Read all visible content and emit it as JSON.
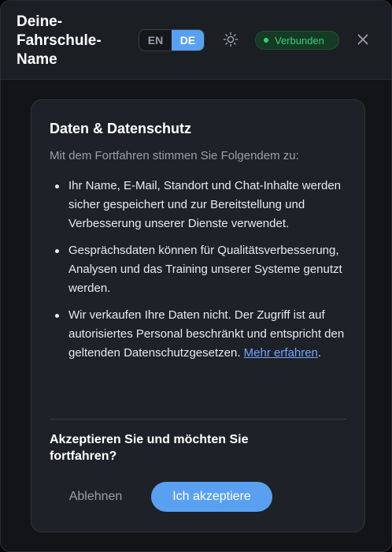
{
  "header": {
    "title": "Deine-Fahrschule-Name",
    "languages": [
      {
        "label": "EN",
        "active": false
      },
      {
        "label": "DE",
        "active": true
      }
    ],
    "theme_icon": "sun-icon",
    "status": {
      "label": "Verbunden",
      "color": "#3bcf74"
    },
    "close_icon": "close-icon"
  },
  "consent": {
    "title": "Daten & Datenschutz",
    "intro": "Mit dem Fortfahren stimmen Sie Folgendem zu:",
    "bullets": [
      "Ihr Name, E-Mail, Standort und Chat-Inhalte werden sicher gespeichert und zur Bereitstellung und Verbesserung unserer Dienste verwendet.",
      "Gesprächsdaten können für Qualitätsverbesserung, Analysen und das Training unserer Systeme genutzt werden.",
      "Wir verkaufen Ihre Daten nicht. Der Zugriff ist auf autorisiertes Personal beschränkt und entspricht den geltenden Datenschutzgesetzen."
    ],
    "learn_more": "Mehr erfahren",
    "question": "Akzeptieren Sie und möchten Sie fortfahren?",
    "decline_label": "Ablehnen",
    "accept_label": "Ich akzeptiere"
  },
  "colors": {
    "accent": "#5aa0f0",
    "status_green": "#3bcf74",
    "link": "#6ea8ff"
  }
}
